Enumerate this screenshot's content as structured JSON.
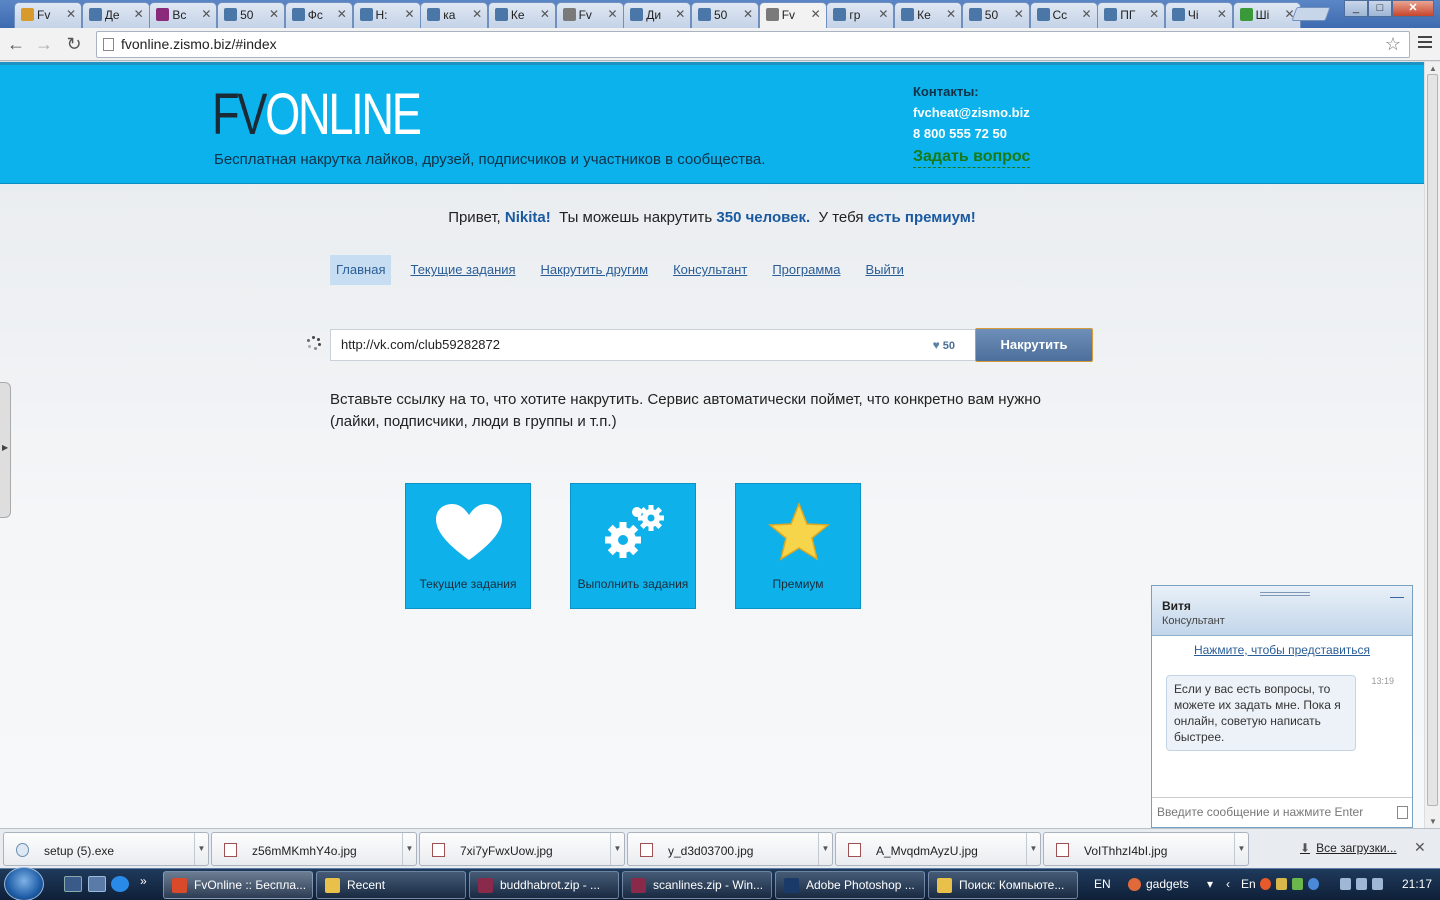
{
  "browser": {
    "tabs": [
      {
        "label": "Fv",
        "icon_color": "#d89a2a"
      },
      {
        "label": "Де",
        "icon_color": "#4a76a8"
      },
      {
        "label": "Вс",
        "icon_color": "#8a2a7a"
      },
      {
        "label": "50",
        "icon_color": "#4a76a8"
      },
      {
        "label": "Фс",
        "icon_color": "#4a76a8"
      },
      {
        "label": "Н:",
        "icon_color": "#4a76a8"
      },
      {
        "label": "ка",
        "icon_color": "#4a76a8"
      },
      {
        "label": "Ке",
        "icon_color": "#4a76a8"
      },
      {
        "label": "Fv",
        "icon_color": "#7a7a7a"
      },
      {
        "label": "Ди",
        "icon_color": "#4a76a8"
      },
      {
        "label": "50",
        "icon_color": "#4a76a8"
      },
      {
        "label": "Fv",
        "icon_color": "#7a7a7a",
        "active": true
      },
      {
        "label": "гр",
        "icon_color": "#4a76a8"
      },
      {
        "label": "Ке",
        "icon_color": "#4a76a8"
      },
      {
        "label": "50",
        "icon_color": "#4a76a8"
      },
      {
        "label": "Сс",
        "icon_color": "#4a76a8"
      },
      {
        "label": "ПГ",
        "icon_color": "#4a76a8"
      },
      {
        "label": "Чі",
        "icon_color": "#4a76a8"
      },
      {
        "label": "Ші",
        "icon_color": "#3a9a3a"
      }
    ],
    "url": "fvonline.zismo.biz/#index"
  },
  "site": {
    "logo_part1": "FV",
    "logo_part2": "ONLINE",
    "tagline": "Бесплатная накрутка лайков, друзей, подписчиков и участников в сообщества.",
    "contacts_label": "Контакты:",
    "email": "fvcheat@zismo.biz",
    "phone": "8 800 555 72 50",
    "ask_link": "Задать вопрос"
  },
  "greeting": {
    "prefix": "Привет,",
    "name": "Nikita!",
    "middle": "Ты можешь накрутить",
    "count": "350 человек.",
    "premium_prefix": "У тебя",
    "premium": "есть премиум!"
  },
  "nav": [
    "Главная",
    "Текущие задания",
    "Накрутить другим",
    "Консультант",
    "Программа",
    "Выйти"
  ],
  "form": {
    "url_value": "http://vk.com/club59282872",
    "likes_count": "50",
    "submit_label": "Накрутить",
    "hint": "Вставьте ссылку на то, что хотите накрутить. Сервис автоматически поймет, что конкретно вам нужно (лайки, подписчики, люди в группы и т.п.)"
  },
  "tiles": [
    {
      "label": "Текущие задания",
      "icon": "heart-icon"
    },
    {
      "label": "Выполнить задания",
      "icon": "gears-icon"
    },
    {
      "label": "Премиум",
      "icon": "star-icon"
    }
  ],
  "chat": {
    "name": "Витя",
    "role": "Консультант",
    "intro_link": "Нажмите, чтобы представиться",
    "time": "13:19",
    "message": "Если у вас есть вопросы, то можете их задать мне. Пока я онлайн, советую написать быстрее.",
    "input_placeholder": "Введите сообщение и нажмите Enter"
  },
  "downloads": {
    "items": [
      "setup (5).exe",
      "z56mMKmhY4o.jpg",
      "7xi7yFwxUow.jpg",
      "y_d3d03700.jpg",
      "A_MvqdmAyzU.jpg",
      "VoIThhzI4bI.jpg"
    ],
    "all_link": "Все загрузки..."
  },
  "taskbar": {
    "tasks": [
      {
        "label": "FvOnline :: Бесплa...",
        "icon_color": "#d84a2a"
      },
      {
        "label": "Recent",
        "icon_color": "#e8c04a"
      },
      {
        "label": "buddhabrot.zip - ...",
        "icon_color": "#8a2a4a"
      },
      {
        "label": "scanlines.zip - Win...",
        "icon_color": "#8a2a4a"
      },
      {
        "label": "Adobe Photoshop ...",
        "icon_color": "#1a3a6a"
      },
      {
        "label": "Поиск: Компьюте...",
        "icon_color": "#e8c04a"
      }
    ],
    "lang": "EN",
    "gadgets": "gadgets",
    "tray_lang": "En",
    "clock": "21:17"
  }
}
